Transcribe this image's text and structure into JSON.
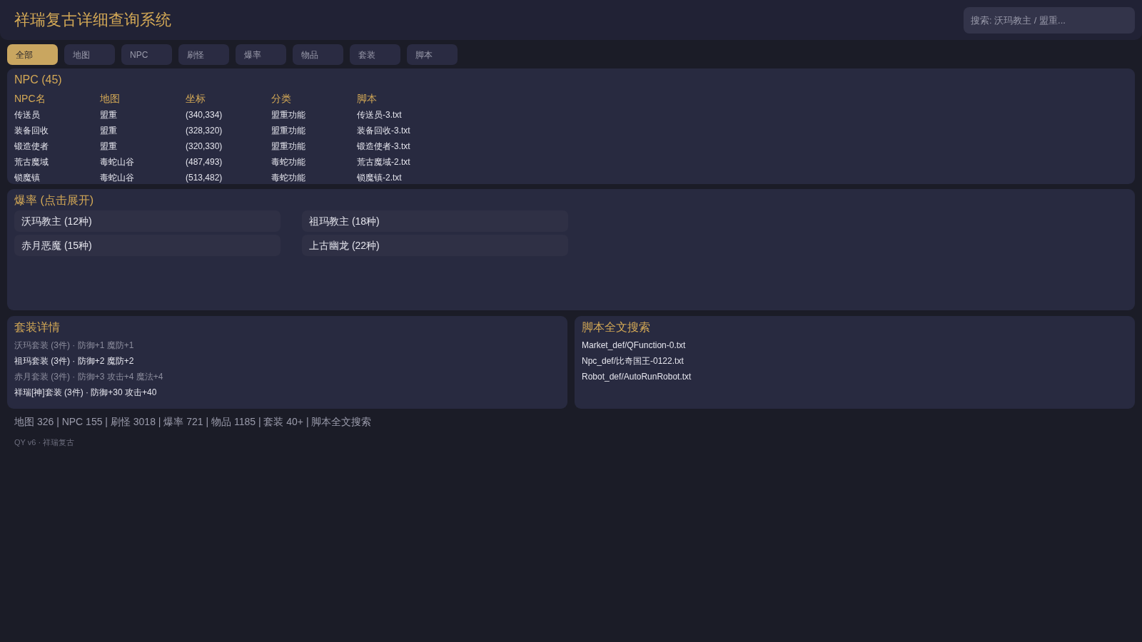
{
  "header": {
    "title": "祥瑞复古详细查询系统",
    "search": {
      "placeholder": "搜索: 沃玛教主 / 盟重..."
    }
  },
  "tabs": [
    {
      "label": "全部",
      "selected": true
    },
    {
      "label": "地图",
      "selected": false
    },
    {
      "label": "NPC",
      "selected": false
    },
    {
      "label": "刷怪",
      "selected": false
    },
    {
      "label": "爆率",
      "selected": false
    },
    {
      "label": "物品",
      "selected": false
    },
    {
      "label": "套装",
      "selected": false
    },
    {
      "label": "脚本",
      "selected": false
    }
  ],
  "npc_panel": {
    "title": "NPC (45)",
    "table": {
      "columns": [
        "NPC名",
        "地图",
        "坐标",
        "分类",
        "脚本"
      ],
      "rows": [
        [
          "传送员",
          "盟重",
          "(340,334)",
          "盟重功能",
          "传送员-3.txt"
        ],
        [
          "装备回收",
          "盟重",
          "(328,320)",
          "盟重功能",
          "装备回收-3.txt"
        ],
        [
          "锻造使者",
          "盟重",
          "(320,330)",
          "盟重功能",
          "锻造使者-3.txt"
        ],
        [
          "荒古魔域",
          "毒蛇山谷",
          "(487,493)",
          "毒蛇功能",
          "荒古魔域-2.txt"
        ],
        [
          "锁魔镇",
          "毒蛇山谷",
          "(513,482)",
          "毒蛇功能",
          "锁魔镇-2.txt"
        ]
      ]
    }
  },
  "drop_panel": {
    "title": "爆率 (点击展开)",
    "items": [
      "沃玛教主 (12种)",
      "祖玛教主 (18种)",
      "赤月恶魔 (15种)",
      "上古幽龙 (22种)"
    ]
  },
  "suit_panel": {
    "title": "套装详情",
    "items": [
      {
        "text": "沃玛套装 (3件) · 防御+1 魔防+1",
        "muted": true
      },
      {
        "text": "祖玛套装 (3件) · 防御+2 魔防+2",
        "muted": false
      },
      {
        "text": "赤月套装 (3件) · 防御+3 攻击+4 魔法+4",
        "muted": true
      },
      {
        "text": "祥瑞[神]套装 (3件) · 防御+30 攻击+40",
        "muted": false
      }
    ]
  },
  "script_panel": {
    "title": "脚本全文搜索",
    "items": [
      "Market_def/QFunction-0.txt",
      "Npc_def/比奇国王-0122.txt",
      "Robot_def/AutoRunRobot.txt"
    ]
  },
  "stats": "地图 326 | NPC 155 | 刷怪 3018 | 爆率 721 | 物品 1185 | 套装 40+ | 脚本全文搜索",
  "footer": "QY v6 · 祥瑞复古"
}
